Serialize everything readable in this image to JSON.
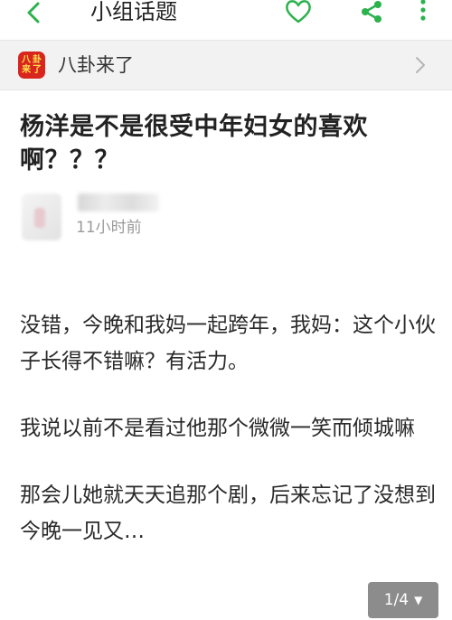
{
  "header": {
    "title": "小组话题",
    "back_icon": "chevron-left-icon",
    "like_icon": "heart-icon",
    "share_icon": "share-icon",
    "more_icon": "more-vertical-icon",
    "accent_color": "#2bb24c"
  },
  "group": {
    "logo_text": [
      "八",
      "卦",
      "来",
      "了"
    ],
    "name": "八卦来了"
  },
  "post": {
    "title": "杨洋是不是很受中年妇女的喜欢啊？？？",
    "time": "11小时前",
    "paragraphs": [
      "没错，今晚和我妈一起跨年，我妈：这个小伙子长得不错嘛？有活力。",
      "我说以前不是看过他那个微微一笑而倾城嘛",
      "那会儿她就天天追那个剧，后来忘记了没想到今晚一见又…"
    ]
  },
  "pager": {
    "label": "1/4",
    "caret": "▼"
  }
}
